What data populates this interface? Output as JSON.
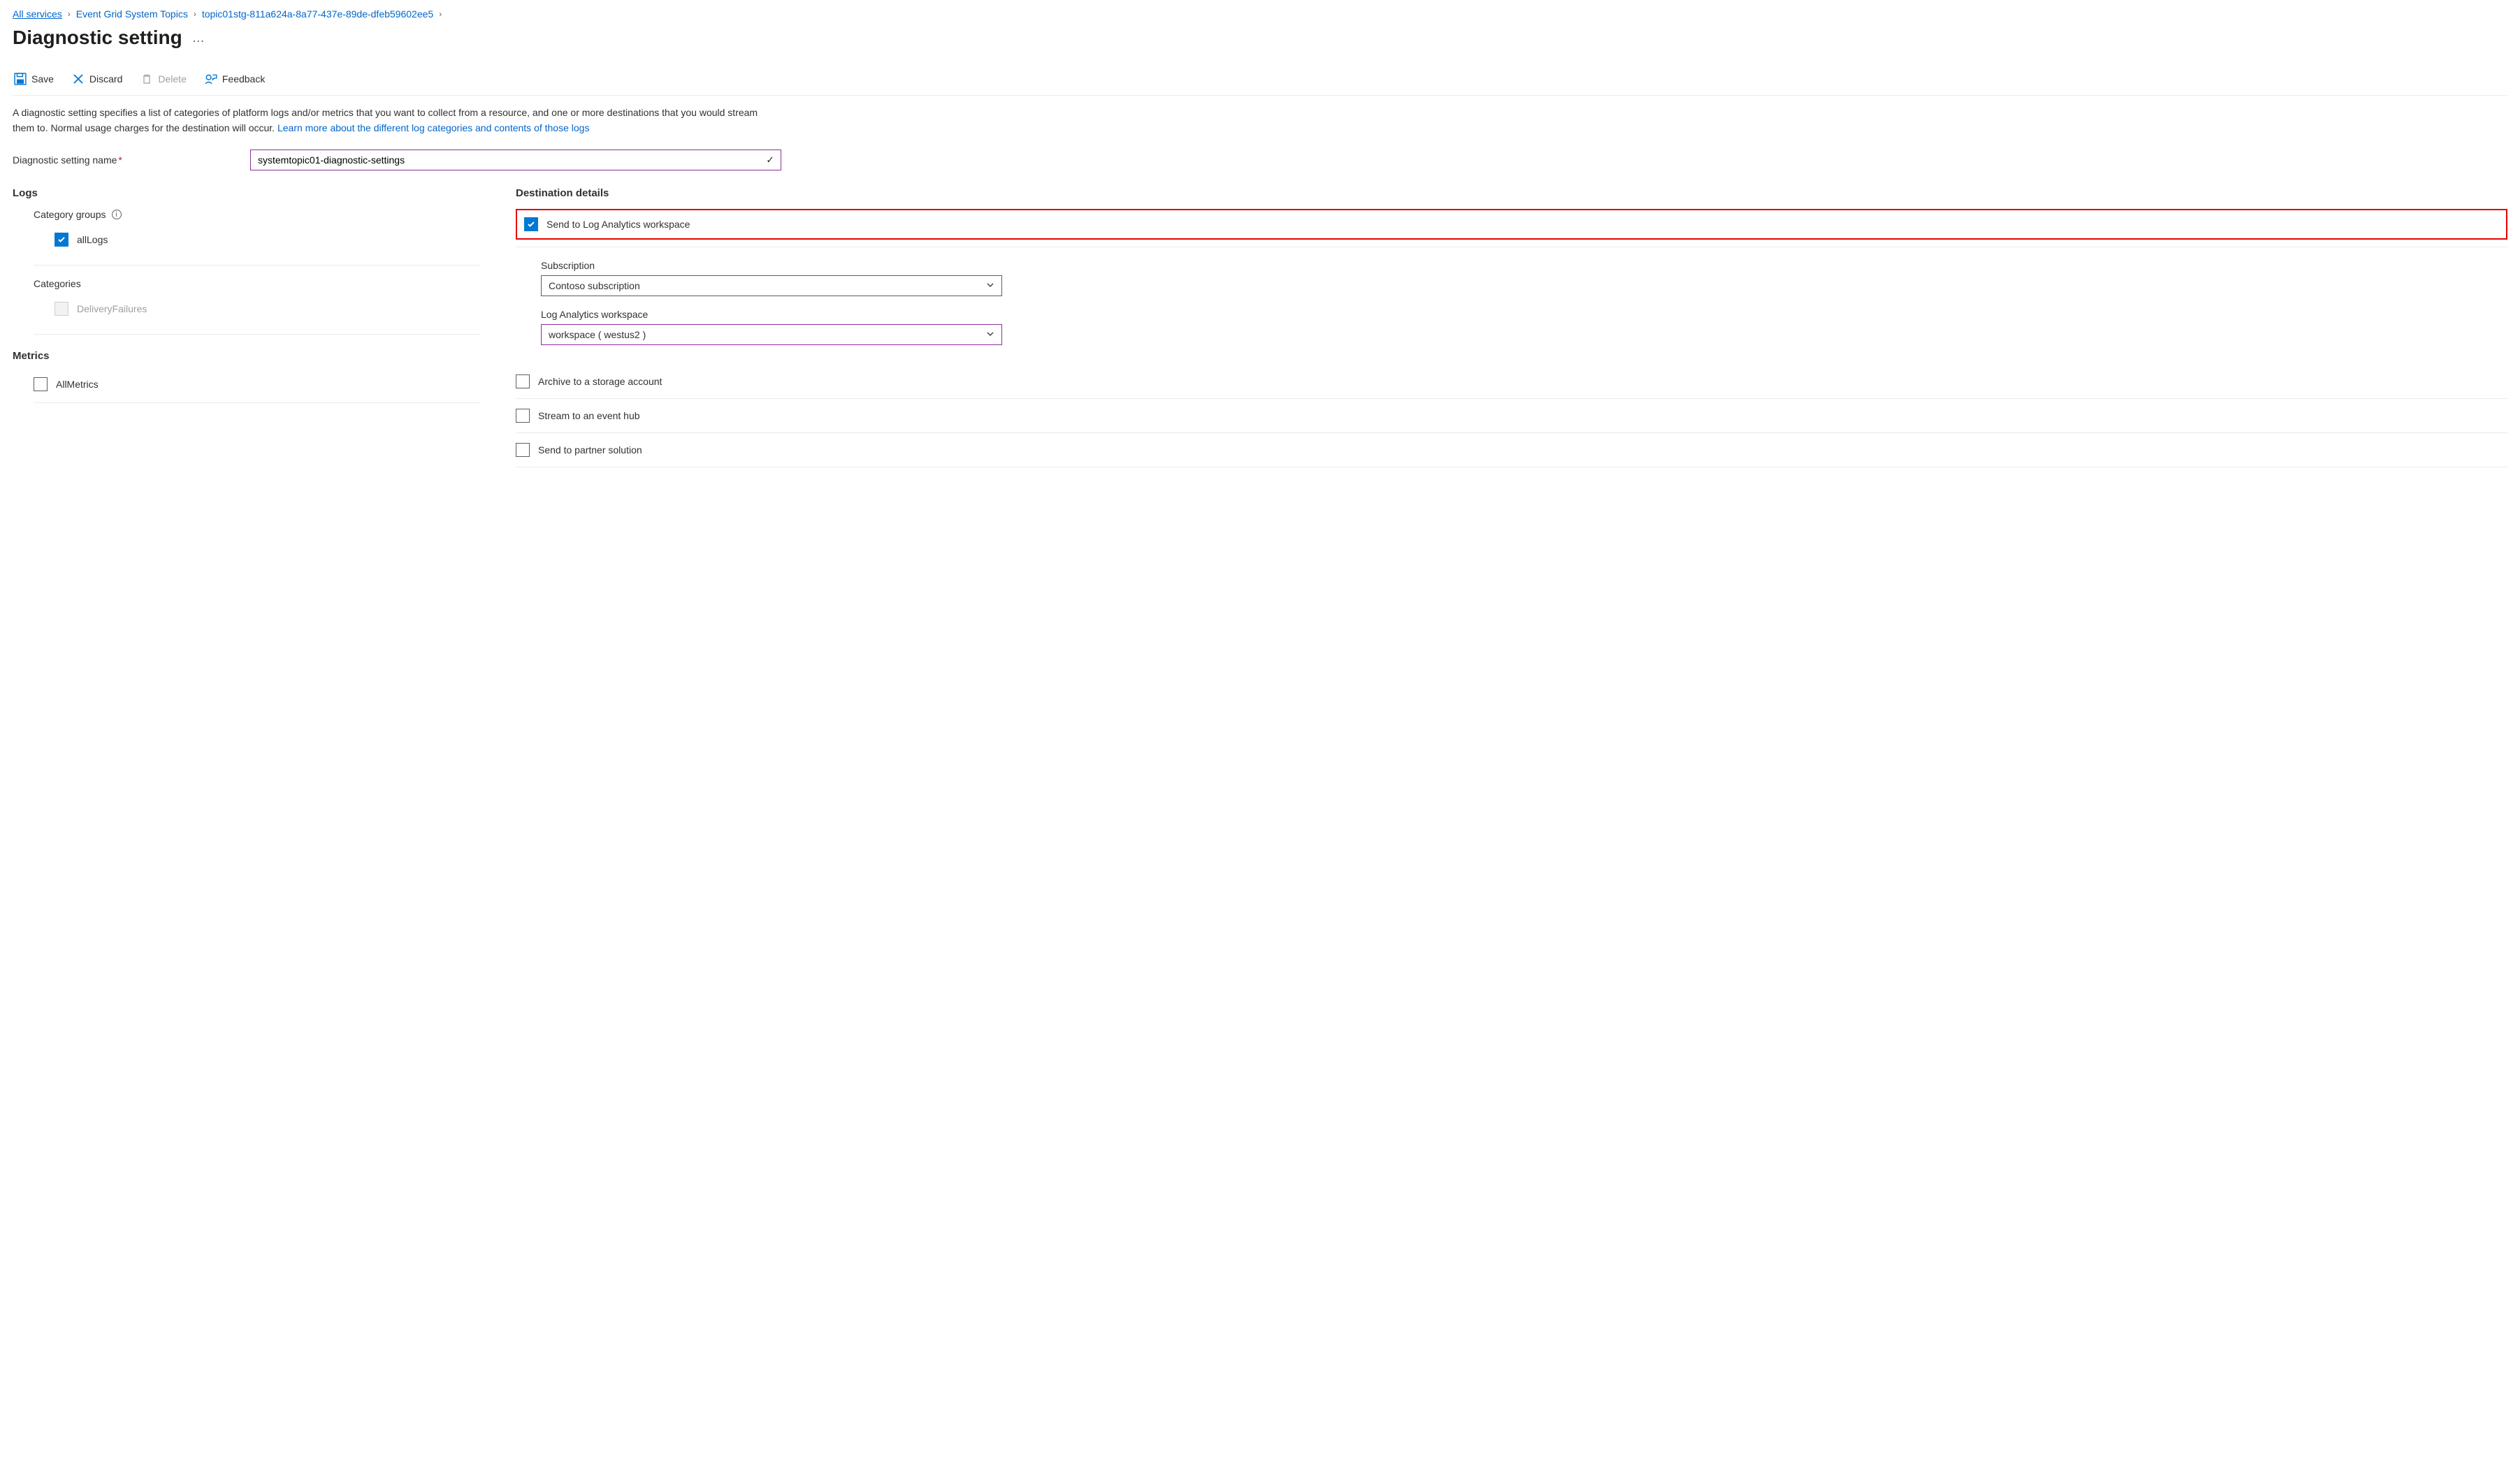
{
  "breadcrumb": {
    "items": [
      {
        "label": "All services"
      },
      {
        "label": "Event Grid System Topics"
      },
      {
        "label": "topic01stg-811a624a-8a77-437e-89de-dfeb59602ee5"
      }
    ]
  },
  "page": {
    "title": "Diagnostic setting"
  },
  "toolbar": {
    "save": "Save",
    "discard": "Discard",
    "delete": "Delete",
    "feedback": "Feedback"
  },
  "description": {
    "text1": "A diagnostic setting specifies a list of categories of platform logs and/or metrics that you want to collect from a resource, and one or more destinations that you would stream them to. Normal usage charges for the destination will occur. ",
    "link": "Learn more about the different log categories and contents of those logs"
  },
  "form": {
    "name_label": "Diagnostic setting name",
    "name_value": "systemtopic01-diagnostic-settings"
  },
  "logs": {
    "heading": "Logs",
    "category_groups_label": "Category groups",
    "all_logs": "allLogs",
    "categories_label": "Categories",
    "delivery_failures": "DeliveryFailures"
  },
  "metrics": {
    "heading": "Metrics",
    "all_metrics": "AllMetrics"
  },
  "dest": {
    "heading": "Destination details",
    "send_law": "Send to Log Analytics workspace",
    "subscription_label": "Subscription",
    "subscription_value": "Contoso subscription",
    "law_label": "Log Analytics workspace",
    "law_value": "workspace ( westus2 )",
    "archive_storage": "Archive to a storage account",
    "stream_eventhub": "Stream to an event hub",
    "send_partner": "Send to partner solution"
  }
}
